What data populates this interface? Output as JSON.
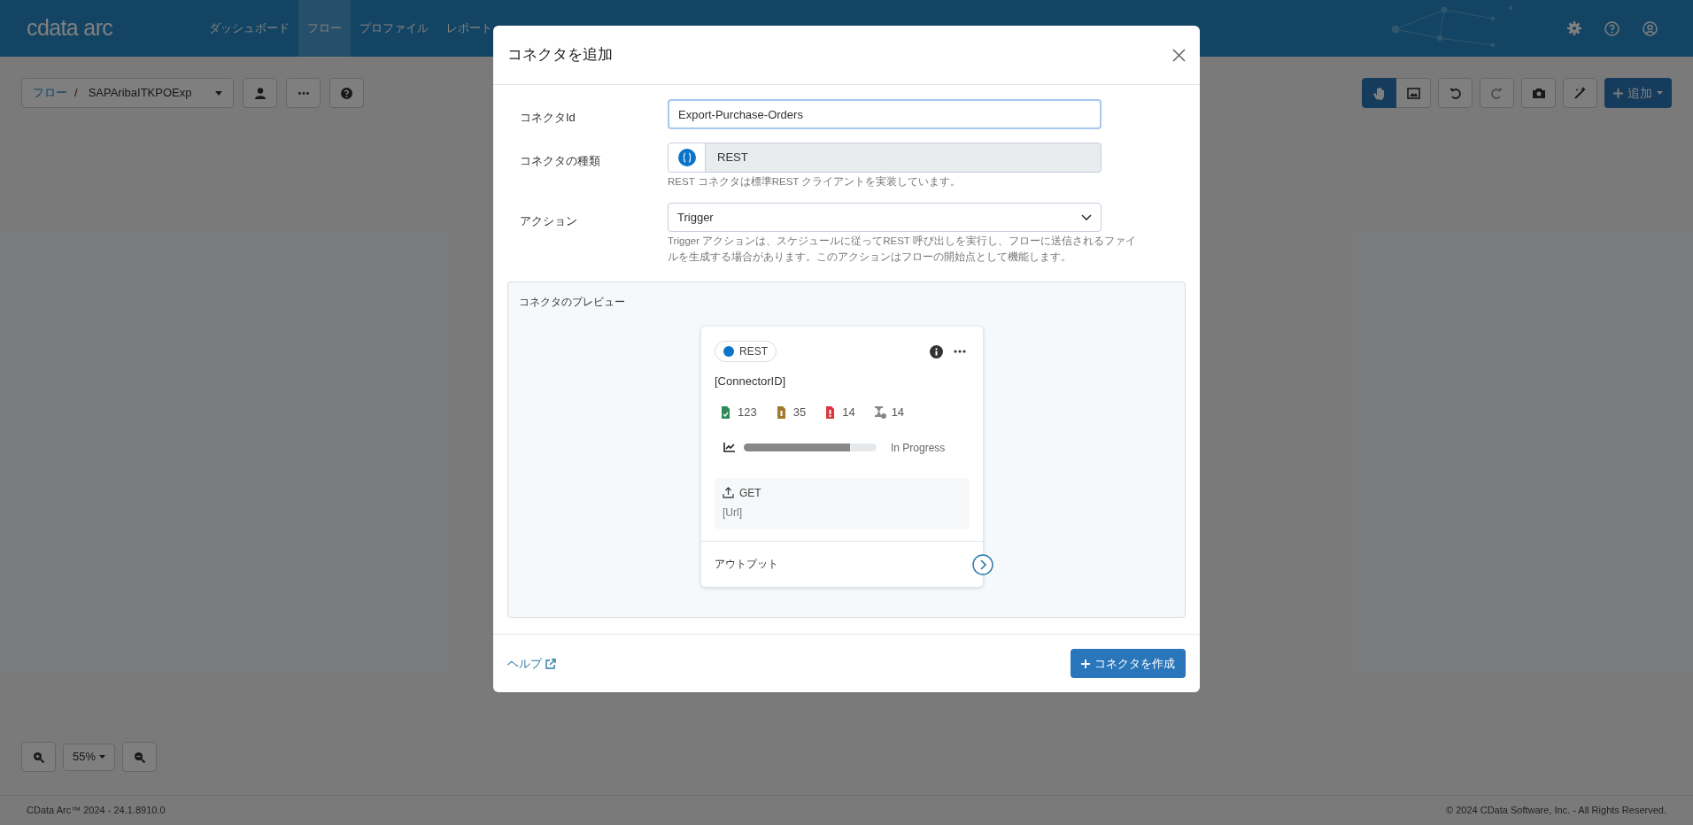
{
  "app": {
    "logo": "cdata arc"
  },
  "nav": [
    {
      "label": "ダッシュボード",
      "selected": false
    },
    {
      "label": "フロー",
      "selected": true
    },
    {
      "label": "プロファイル",
      "selected": false
    },
    {
      "label": "レポート",
      "selected": false
    }
  ],
  "breadcrumb": {
    "root": "フロー",
    "separator": "/",
    "flow": "SAPAribaITKPOExp"
  },
  "toolbar": {
    "add_button": "追加",
    "pan_mode": true
  },
  "zoom": {
    "value": "55%"
  },
  "footer": {
    "version": "CData Arc™ 2024 - 24.1.8910.0",
    "copyright": "© 2024 CData Software, Inc. - All Rights Reserved."
  },
  "modal": {
    "title": "コネクタを追加",
    "fields": [
      {
        "kind": "input",
        "label": "コネクタId",
        "value": "Export-Purchase-Orders"
      },
      {
        "kind": "readonly",
        "label": "コネクタの種類",
        "value": "REST",
        "help": "REST コネクタは標準REST クライアントを実装しています。"
      },
      {
        "kind": "select",
        "label": "アクション",
        "value": "Trigger",
        "help": "Trigger アクションは、スケジュールに従ってREST 呼び出しを実行し、フローに送信されるファイルを生成する場合があります。このアクションはフローの開始点として機能します。"
      }
    ],
    "preview": {
      "title": "コネクタのプレビュー",
      "card": {
        "type": "REST",
        "id": "[ConnectorID]",
        "stats": [
          {
            "kind": "success",
            "count": "123",
            "color": "#2e8b57"
          },
          {
            "kind": "pending",
            "count": "35",
            "color": "#a07a2c"
          },
          {
            "kind": "error",
            "count": "14",
            "color": "#d9363e"
          },
          {
            "kind": "skipped",
            "count": "14",
            "color": "#888888"
          }
        ],
        "progress": {
          "level": 0.8,
          "status": "In Progress"
        },
        "method": "GET",
        "url": "[Url]",
        "output": "アウトプット"
      }
    },
    "help_link": "ヘルプ",
    "create_button": "コネクタを作成"
  }
}
